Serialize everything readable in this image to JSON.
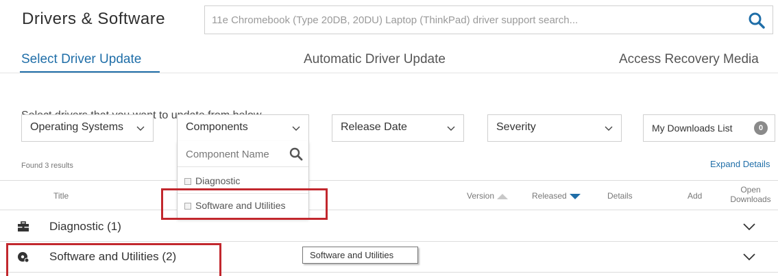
{
  "header": {
    "title": "Drivers & Software",
    "search_placeholder": "11e Chromebook (Type 20DB, 20DU) Laptop (ThinkPad) driver support search...",
    "search_icon": "search-icon"
  },
  "tabs": [
    {
      "label": "Select Driver Update",
      "active": true
    },
    {
      "label": "Automatic Driver Update",
      "active": false
    },
    {
      "label": "Access Recovery Media",
      "active": false
    }
  ],
  "instructions": "Select drivers that you want to update from below",
  "filters": {
    "operating_systems": "Operating Systems",
    "components": "Components",
    "release_date": "Release Date",
    "severity": "Severity",
    "my_downloads": "My Downloads List",
    "downloads_count": "0"
  },
  "components_dropdown": {
    "search_placeholder": "Component Name",
    "options": [
      "Diagnostic",
      "Software and Utilities"
    ]
  },
  "results": {
    "found_text": "Found 3 results",
    "expand_details": "Expand Details"
  },
  "table_headers": {
    "title": "Title",
    "version": "Version",
    "released": "Released",
    "details": "Details",
    "add": "Add",
    "open_downloads_line1": "Open",
    "open_downloads_line2": "Downloads"
  },
  "rows": [
    {
      "label": "Diagnostic (1)",
      "icon": "toolbox-icon"
    },
    {
      "label": "Software and Utilities (2)",
      "icon": "disc-icon"
    }
  ],
  "tooltip": "Software and Utilities",
  "colors": {
    "accent": "#1f6ea8",
    "highlight": "#c2272d"
  }
}
